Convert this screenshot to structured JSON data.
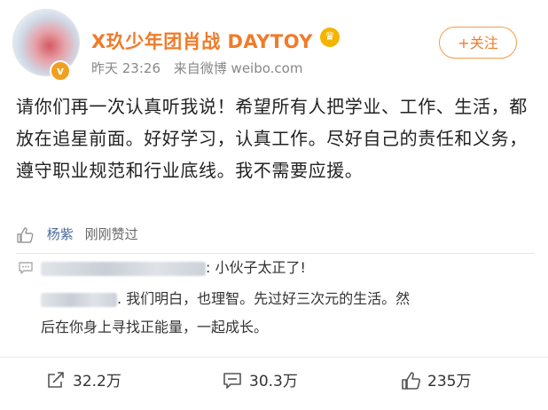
{
  "header": {
    "username": "X玖少年团肖战 DAYTOY",
    "time": "昨天 23:26",
    "source": "来自微博 weibo.com",
    "follow_label": "+关注",
    "avatar_badge": "v"
  },
  "post": {
    "text": "请你们再一次认真听我说！希望所有人把学业、工作、生活，都放在追星前面。好好学习，认真工作。尽好自己的责任和义务，遵守职业规范和行业底线。我不需要应援。"
  },
  "likes_row": {
    "name": "杨紫",
    "text": "刚刚赞过"
  },
  "comments": [
    {
      "text": ": 小伙子太正了!"
    },
    {
      "text": ". 我们明白，也理智。先过好三次元的生活。然",
      "cont": "后在你身上寻找正能量，一起成长。"
    }
  ],
  "actions": {
    "repost": "32.2万",
    "comment": "30.3万",
    "like": "235万"
  },
  "colors": {
    "username": "#f07b2a",
    "liker_name": "#4b6b9b",
    "follow_border": "#f59b4c"
  }
}
